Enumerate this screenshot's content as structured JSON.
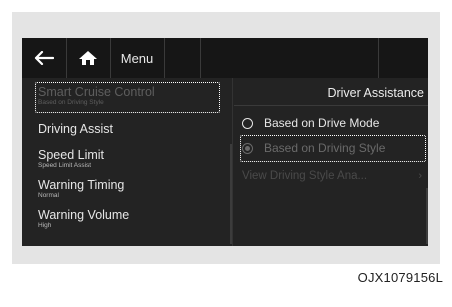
{
  "topbar": {
    "back_icon": "arrow-left-icon",
    "home_icon": "home-icon",
    "menu_label": "Menu"
  },
  "left_list": {
    "items": [
      {
        "label": "Smart Cruise Control",
        "sub": "Based on Driving Style",
        "state": "dimmed-focused"
      },
      {
        "label": "Driving Assist",
        "sub": ""
      },
      {
        "label": "Speed Limit",
        "sub": "Speed Limit Assist"
      },
      {
        "label": "Warning Timing",
        "sub": "Normal"
      },
      {
        "label": "Warning Volume",
        "sub": "High"
      }
    ]
  },
  "right_pane": {
    "title": "Driver Assistance",
    "options": [
      {
        "label": "Based on Drive Mode",
        "selected": false
      },
      {
        "label": "Based on Driving Style",
        "selected": true
      }
    ],
    "view_link": "View Driving Style Ana...",
    "view_chevron": "›"
  },
  "figure_code": "OJX1079156L",
  "colors": {
    "screen_bg": "#232323",
    "topbar_bg": "#161616",
    "frame_bg": "#e4e4e4",
    "focus_outline": "#ffffff"
  }
}
